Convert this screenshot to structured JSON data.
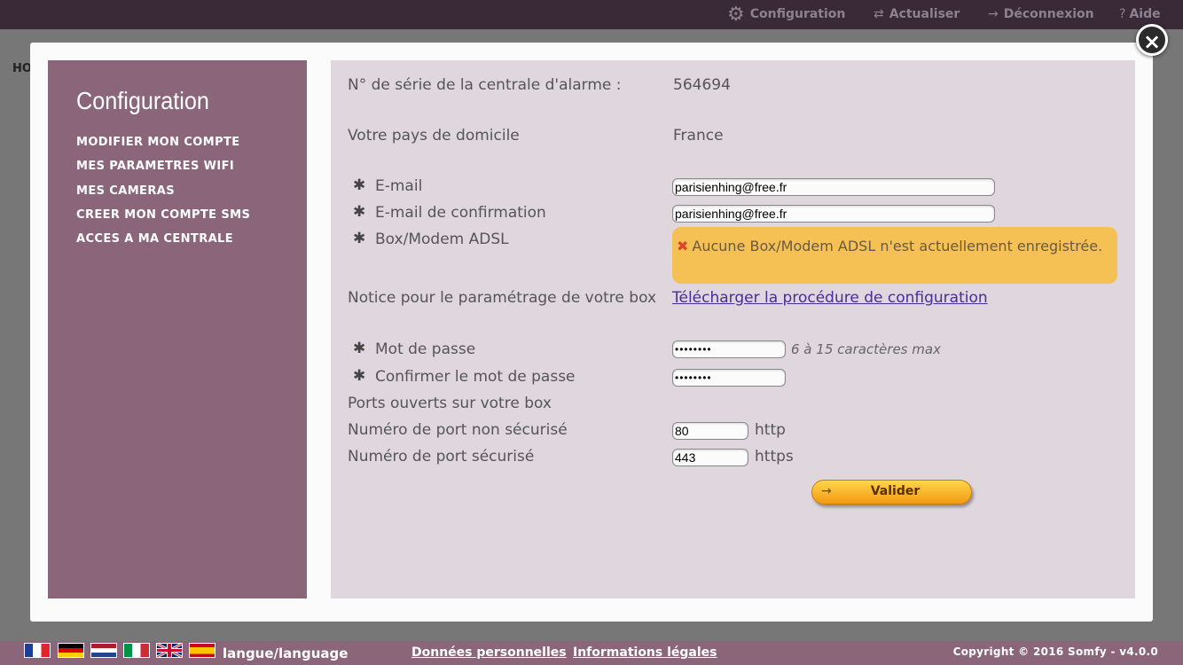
{
  "topnav": {
    "items": [
      {
        "label": "Configuration",
        "icon": "gear-icon"
      },
      {
        "label": "Actualiser",
        "icon": "refresh-icon"
      },
      {
        "label": "Déconnexion",
        "icon": "arrow-right-icon"
      },
      {
        "label": "Aide",
        "icon": "question-icon"
      }
    ],
    "icon_glyphs": {
      "gear": "⚙",
      "refresh": "⇄",
      "arrow": "→",
      "question": "?"
    }
  },
  "background": {
    "home_partial": "HO"
  },
  "modal": {
    "close_glyph": "×",
    "sidebar": {
      "title": "Configuration",
      "items": [
        "MODIFIER MON COMPTE",
        "MES PARAMETRES WIFI",
        "MES CAMERAS",
        "CREER MON COMPTE SMS",
        "ACCES A MA CENTRALE"
      ]
    },
    "form": {
      "serial_label": "N° de série de la centrale d'alarme :",
      "serial_value": "564694",
      "country_label": "Votre pays de domicile",
      "country_value": "France",
      "required_marker": "✱",
      "email_label": "E-mail",
      "email_value": "parisienhing@free.fr",
      "email_confirm_label": "E-mail de confirmation",
      "email_confirm_value": "parisienhing@free.fr",
      "box_label": "Box/Modem ADSL",
      "box_warning_icon": "✖",
      "box_warning": "Aucune Box/Modem ADSL n'est actuellement enregistrée.",
      "notice_label": "Notice pour le paramétrage de votre box",
      "notice_link": "Télécharger la procédure de configuration",
      "password_label": "Mot de passe",
      "password_value": "••••••••",
      "password_hint": "6 à 15 caractères max",
      "password_confirm_label": "Confirmer le mot de passe",
      "password_confirm_value": "••••••••",
      "ports_label": "Ports ouverts sur votre box",
      "port_http_label": "Numéro de port non sécurisé",
      "port_http_value": "80",
      "port_http_unit": "http",
      "port_https_label": "Numéro de port sécurisé",
      "port_https_value": "443",
      "port_https_unit": "https",
      "submit_arrow": "→",
      "submit_label": "Valider"
    }
  },
  "footer": {
    "flags": [
      "france-flag",
      "germany-flag",
      "netherlands-flag",
      "italy-flag",
      "uk-flag",
      "spain-flag"
    ],
    "language_label": "langue/language",
    "personal_data_link": "Données personnelles",
    "legal_link": "Informations légales",
    "copyright": "Copyright © 2016 Somfy - v4.0.0"
  },
  "colors": {
    "topbar": "#3a2a37",
    "sidebar": "#8b667b",
    "content": "#e0d6de",
    "warning": "#f5c155",
    "button": "#f29a11"
  }
}
